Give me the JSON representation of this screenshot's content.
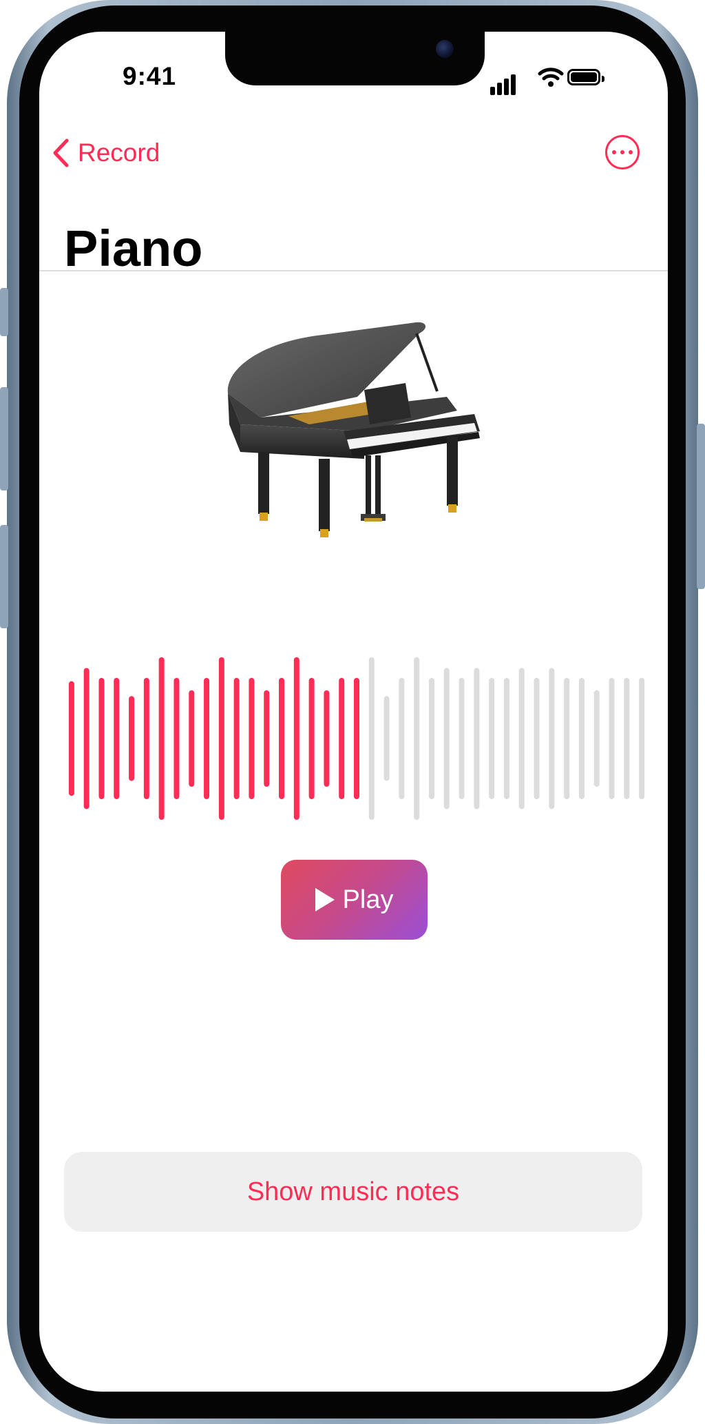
{
  "status_bar": {
    "time": "9:41",
    "signal_icon": "cellular-signal-icon",
    "wifi_icon": "wifi-icon",
    "battery_icon": "battery-icon"
  },
  "nav": {
    "back_label": "Record",
    "back_icon": "chevron-left-icon",
    "more_icon": "ellipsis-circle-icon"
  },
  "title": "Piano",
  "hero": {
    "icon": "grand-piano-image"
  },
  "waveform": {
    "played_color": "#ff2d55",
    "unplayed_color": "#dcdcdc",
    "progress": 0.52,
    "bar_levels": [
      0.66,
      0.82,
      0.7,
      0.7,
      0.48,
      0.7,
      0.95,
      0.7,
      0.55,
      0.7,
      0.95,
      0.7,
      0.7,
      0.55,
      0.7,
      0.95,
      0.7,
      0.55,
      0.7,
      0.7,
      0.95,
      0.48,
      0.7,
      0.95,
      0.7,
      0.82,
      0.7,
      0.82,
      0.7,
      0.7,
      0.82,
      0.7,
      0.82,
      0.7,
      0.7,
      0.55,
      0.7,
      0.7,
      0.7
    ]
  },
  "actions": {
    "play_label": "Play",
    "play_icon": "play-icon",
    "show_notes_label": "Show music notes"
  },
  "colors": {
    "accent": "#ff2d55",
    "play_gradient_start": "#e04a5e",
    "play_gradient_end": "#9a4fd6"
  }
}
